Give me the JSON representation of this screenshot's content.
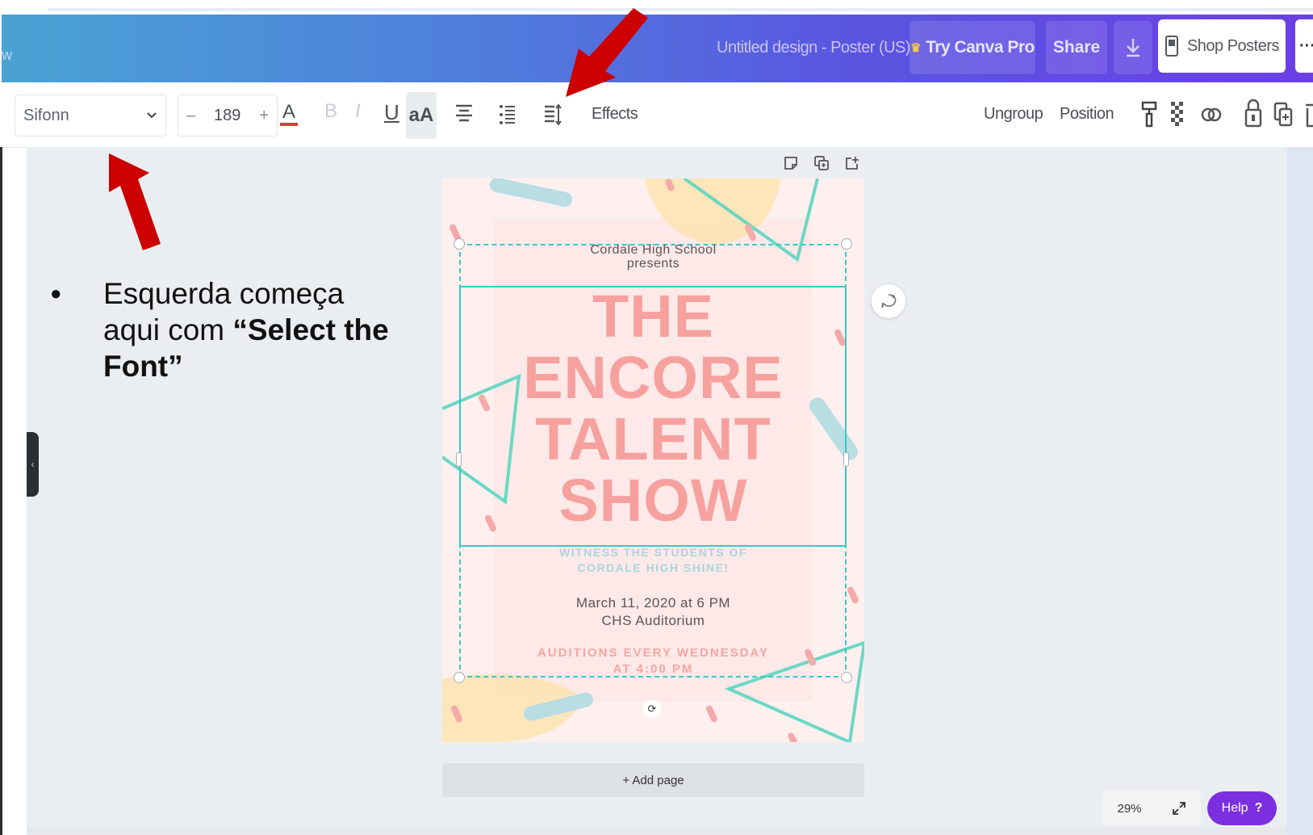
{
  "header": {
    "left_fragment": "w",
    "doc_title": "Untitled design - Poster (US)",
    "try_pro_label": "Try Canva Pro",
    "share_label": "Share",
    "shop_label": "Shop Posters",
    "more_label": "···"
  },
  "toolbar": {
    "font_name": "Sifonn",
    "size_minus": "–",
    "font_size": "189",
    "size_plus": "+",
    "text_color_glyph": "A",
    "bold_glyph": "B",
    "italic_glyph": "I",
    "underline_glyph": "U",
    "case_glyph": "aA",
    "effects_label": "Effects",
    "ungroup_label": "Ungroup",
    "position_label": "Position"
  },
  "poster": {
    "school": "Cordale High School",
    "presents": "presents",
    "title_lines": [
      "THE",
      "ENCORE",
      "TALENT",
      "SHOW"
    ],
    "witness_1": "WITNESS THE STUDENTS OF",
    "witness_2": "CORDALE HIGH SHINE!",
    "date": "March 11, 2020 at 6 PM",
    "venue": "CHS Auditorium",
    "auditions_1": "AUDITIONS EVERY WEDNESDAY",
    "auditions_2": "AT 4:00 PM"
  },
  "canvas": {
    "add_page_label": "+ Add page",
    "zoom_level": "29%",
    "help_label": "Help",
    "help_glyph": "?"
  },
  "annotation": {
    "bullet": "●",
    "text_plain": "Esquerda começa aqui com ",
    "text_bold": "“Select the Font”"
  },
  "colors": {
    "accent_purple": "#7b2fe0",
    "selection_teal": "#39c9c7",
    "title_pink": "#f6a19e",
    "arrow_red": "#cc0000"
  },
  "icons": [
    "download-icon",
    "shop-poster-icon",
    "chevron-down-icon",
    "align-icon",
    "list-icon",
    "spacing-icon",
    "paint-format-icon",
    "transparency-icon",
    "link-icon",
    "lock-icon",
    "copy-icon",
    "trash-icon",
    "note-icon",
    "duplicate-icon",
    "add-page-icon",
    "regenerate-icon",
    "rotate-icon",
    "expand-icon",
    "collapse-chevron-icon"
  ]
}
